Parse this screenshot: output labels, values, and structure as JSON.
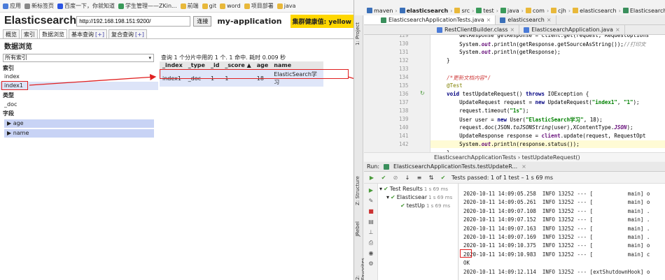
{
  "bookmarks": [
    {
      "label": "应用",
      "icon": "apps-icon",
      "color": "#4a7bd8"
    },
    {
      "label": "新标签页",
      "icon": "page-icon",
      "color": "#888888"
    },
    {
      "label": "百度一下，你就知道",
      "icon": "baidu-icon",
      "color": "#2b54e3"
    },
    {
      "label": "学生管理——ZKin...",
      "icon": "globe-icon",
      "color": "#3a9a5a"
    },
    {
      "label": "前端",
      "icon": "folder-icon",
      "color": "#e8b83a"
    },
    {
      "label": "git",
      "icon": "folder-icon",
      "color": "#e8b83a"
    },
    {
      "label": "word",
      "icon": "folder-icon",
      "color": "#e8b83a"
    },
    {
      "label": "项目部署",
      "icon": "folder-icon",
      "color": "#e8b83a"
    },
    {
      "label": "java",
      "icon": "folder-icon",
      "color": "#e8b83a"
    }
  ],
  "es": {
    "title": "Elasticsearch",
    "url": "http://192.168.198.151:9200/",
    "connect": "连接",
    "cluster": "my-application",
    "health": "集群健康值: yellow",
    "health_color": "#ffd700",
    "tabs": [
      {
        "label": "概览"
      },
      {
        "label": "索引"
      },
      {
        "label": "数据浏览"
      },
      {
        "label": "基本查询",
        "plus": "[+]"
      },
      {
        "label": "复合查询",
        "plus": "[+]"
      }
    ],
    "section_title": "数据浏览",
    "index_select": "所有索引",
    "labels": {
      "index": "索引",
      "type": "类型",
      "field": "字段"
    },
    "indices": [
      "index",
      "index1"
    ],
    "types": [
      "_doc"
    ],
    "fields": [
      "age",
      "name"
    ],
    "query_info": "查询 1 个分片中用的 1 个. 1 命中. 耗时 0.009 秒",
    "columns": [
      "_index",
      "_type",
      "_id",
      "_score ▲",
      "age",
      "name"
    ],
    "rows": [
      [
        "index1",
        "_doc",
        "1",
        "1",
        "18",
        "ElasticSearch学习"
      ]
    ]
  },
  "ide": {
    "breadcrumbs": [
      "maven",
      "elasticsearch",
      "src",
      "test",
      "java",
      "com",
      "cjh",
      "elasticsearch",
      "ElasticsearchApplicationT"
    ],
    "sidebar_left": [
      "1: Project",
      "Z: Structure",
      "JRebel",
      "2: Favorites"
    ],
    "tabs_row1": [
      "ElasticsearchApplicationTests.java",
      "elasticsearch"
    ],
    "tabs_row2": [
      "RestClientBuilder.class",
      "ElasticsearchApplication.java"
    ],
    "line_numbers": [
      "129",
      "130",
      "131",
      "132",
      "133",
      "134",
      "135",
      "136",
      "137",
      "138",
      "139",
      "140",
      "141",
      "142"
    ],
    "code_crumb": "ElasticsearchApplicationTests  ›  testUpdateRequest()",
    "run_label": "Run:",
    "run_config": "ElasticsearchApplicationTests.testUpdateR...",
    "tests_passed": "Tests passed: 1 of 1 test – 1 s 69 ms",
    "tree": [
      {
        "label": "Test Results",
        "time": "1 s 69 ms"
      },
      {
        "label": "Elasticsear",
        "time": "1 s 69 ms"
      },
      {
        "label": "testUp",
        "time": "1 s 69 ms"
      }
    ],
    "console": [
      "2020-10-11 14:09:05.258  INFO 13252 --- [           main] o",
      "2020-10-11 14:09:05.261  INFO 13252 --- [           main] o",
      "2020-10-11 14:09:07.108  INFO 13252 --- [           main] .",
      "2020-10-11 14:09:07.152  INFO 13252 --- [           main] .",
      "2020-10-11 14:09:07.163  INFO 13252 --- [           main] .",
      "2020-10-11 14:09:07.169  INFO 13252 --- [           main] .",
      "2020-10-11 14:09:10.375  INFO 13252 --- [           main] o",
      "2020-10-11 14:09:10.983  INFO 13252 --- [           main] c",
      "OK",
      "2020-10-11 14:09:12.114  INFO 13252 --- [extShutdownHook] o"
    ]
  }
}
